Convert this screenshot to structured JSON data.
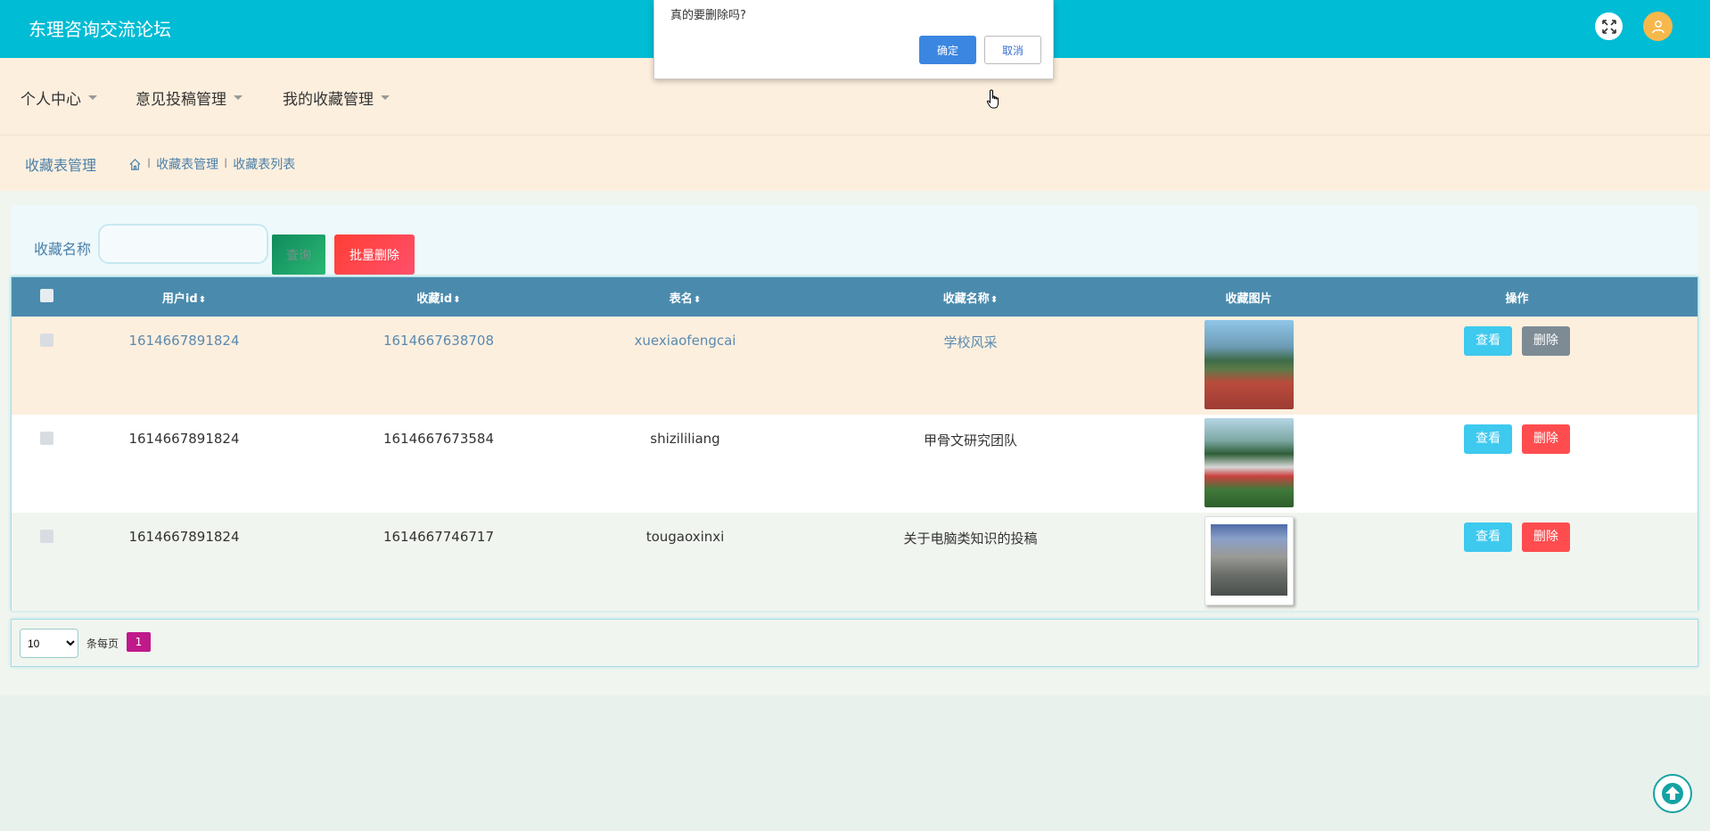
{
  "header": {
    "brand": "东理咨询交流论坛",
    "fullscreen_icon": "fullscreen-icon",
    "user_icon": "user-icon",
    "colors": {
      "topbar": "#00bcd4",
      "nav": "#fdefde",
      "accent": "#4a8bad"
    }
  },
  "nav": {
    "items": [
      {
        "label": "个人中心"
      },
      {
        "label": "意见投稿管理"
      },
      {
        "label": "我的收藏管理"
      }
    ]
  },
  "breadcrumb": {
    "title": "收藏表管理",
    "home_icon": "home-icon",
    "sep": "I",
    "path": [
      "收藏表管理",
      "收藏表列表"
    ]
  },
  "search": {
    "label": "收藏名称",
    "value": "",
    "search_button": "查询",
    "batch_delete_button": "批量删除"
  },
  "table": {
    "columns": [
      "用户id",
      "收藏id",
      "表名",
      "收藏名称",
      "收藏图片",
      "操作"
    ],
    "sort_icon": "⬍",
    "view_label": "查看",
    "delete_label": "删除",
    "rows": [
      {
        "user_id": "1614667891824",
        "fav_id": "1614667638708",
        "table_name": "xuexiaofengcai",
        "fav_name": "学校风采",
        "image": "campus-sports-photo"
      },
      {
        "user_id": "1614667891824",
        "fav_id": "1614667673584",
        "table_name": "shizililiang",
        "fav_name": "甲骨文研究团队",
        "image": "team-group-photo"
      },
      {
        "user_id": "1614667891824",
        "fav_id": "1614667746717",
        "table_name": "tougaoxinxi",
        "fav_name": "关于电脑类知识的投稿",
        "image": "university-gate-photo"
      }
    ]
  },
  "pagination": {
    "page_size": "10",
    "per_page_label": "条每页",
    "current_page": "1"
  },
  "dialog": {
    "message": "真的要删除吗?",
    "ok": "确定",
    "cancel": "取消"
  }
}
